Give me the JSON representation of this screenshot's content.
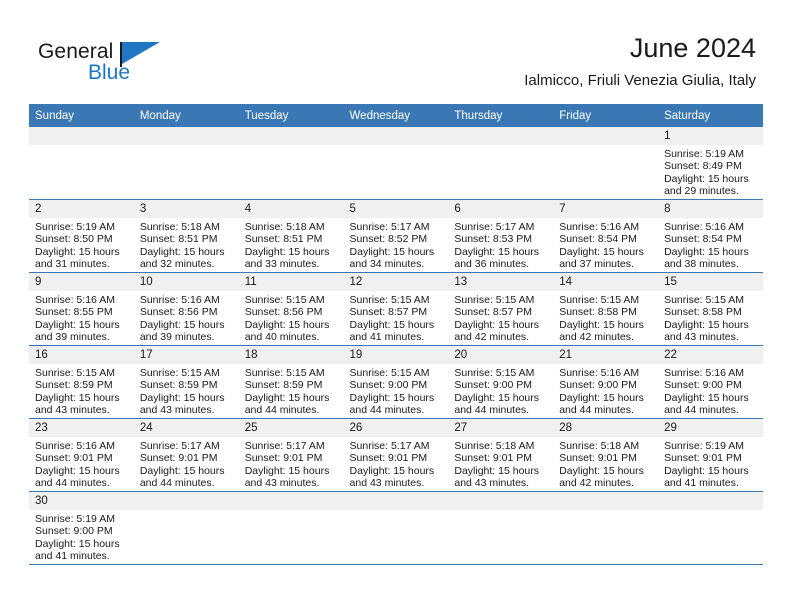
{
  "logo": {
    "text_primary": "General",
    "text_secondary": "Blue",
    "flag_icon": "blue-flag-icon",
    "primary_color": "#1a1a1a",
    "accent_color": "#1f77c4"
  },
  "header": {
    "title": "June 2024",
    "subtitle": "Ialmicco, Friuli Venezia Giulia, Italy"
  },
  "theme": {
    "header_bg": "#3a78b5",
    "header_text": "#ffffff",
    "daynum_bg": "#f0f0f0",
    "row_border": "#3a78b5"
  },
  "calendar": {
    "weekday_headers": [
      "Sunday",
      "Monday",
      "Tuesday",
      "Wednesday",
      "Thursday",
      "Friday",
      "Saturday"
    ],
    "weeks": [
      [
        {
          "day": "",
          "sunrise": "",
          "sunset": "",
          "daylight_line1": "",
          "daylight_line2": ""
        },
        {
          "day": "",
          "sunrise": "",
          "sunset": "",
          "daylight_line1": "",
          "daylight_line2": ""
        },
        {
          "day": "",
          "sunrise": "",
          "sunset": "",
          "daylight_line1": "",
          "daylight_line2": ""
        },
        {
          "day": "",
          "sunrise": "",
          "sunset": "",
          "daylight_line1": "",
          "daylight_line2": ""
        },
        {
          "day": "",
          "sunrise": "",
          "sunset": "",
          "daylight_line1": "",
          "daylight_line2": ""
        },
        {
          "day": "",
          "sunrise": "",
          "sunset": "",
          "daylight_line1": "",
          "daylight_line2": ""
        },
        {
          "day": "1",
          "sunrise": "Sunrise: 5:19 AM",
          "sunset": "Sunset: 8:49 PM",
          "daylight_line1": "Daylight: 15 hours",
          "daylight_line2": "and 29 minutes."
        }
      ],
      [
        {
          "day": "2",
          "sunrise": "Sunrise: 5:19 AM",
          "sunset": "Sunset: 8:50 PM",
          "daylight_line1": "Daylight: 15 hours",
          "daylight_line2": "and 31 minutes."
        },
        {
          "day": "3",
          "sunrise": "Sunrise: 5:18 AM",
          "sunset": "Sunset: 8:51 PM",
          "daylight_line1": "Daylight: 15 hours",
          "daylight_line2": "and 32 minutes."
        },
        {
          "day": "4",
          "sunrise": "Sunrise: 5:18 AM",
          "sunset": "Sunset: 8:51 PM",
          "daylight_line1": "Daylight: 15 hours",
          "daylight_line2": "and 33 minutes."
        },
        {
          "day": "5",
          "sunrise": "Sunrise: 5:17 AM",
          "sunset": "Sunset: 8:52 PM",
          "daylight_line1": "Daylight: 15 hours",
          "daylight_line2": "and 34 minutes."
        },
        {
          "day": "6",
          "sunrise": "Sunrise: 5:17 AM",
          "sunset": "Sunset: 8:53 PM",
          "daylight_line1": "Daylight: 15 hours",
          "daylight_line2": "and 36 minutes."
        },
        {
          "day": "7",
          "sunrise": "Sunrise: 5:16 AM",
          "sunset": "Sunset: 8:54 PM",
          "daylight_line1": "Daylight: 15 hours",
          "daylight_line2": "and 37 minutes."
        },
        {
          "day": "8",
          "sunrise": "Sunrise: 5:16 AM",
          "sunset": "Sunset: 8:54 PM",
          "daylight_line1": "Daylight: 15 hours",
          "daylight_line2": "and 38 minutes."
        }
      ],
      [
        {
          "day": "9",
          "sunrise": "Sunrise: 5:16 AM",
          "sunset": "Sunset: 8:55 PM",
          "daylight_line1": "Daylight: 15 hours",
          "daylight_line2": "and 39 minutes."
        },
        {
          "day": "10",
          "sunrise": "Sunrise: 5:16 AM",
          "sunset": "Sunset: 8:56 PM",
          "daylight_line1": "Daylight: 15 hours",
          "daylight_line2": "and 39 minutes."
        },
        {
          "day": "11",
          "sunrise": "Sunrise: 5:15 AM",
          "sunset": "Sunset: 8:56 PM",
          "daylight_line1": "Daylight: 15 hours",
          "daylight_line2": "and 40 minutes."
        },
        {
          "day": "12",
          "sunrise": "Sunrise: 5:15 AM",
          "sunset": "Sunset: 8:57 PM",
          "daylight_line1": "Daylight: 15 hours",
          "daylight_line2": "and 41 minutes."
        },
        {
          "day": "13",
          "sunrise": "Sunrise: 5:15 AM",
          "sunset": "Sunset: 8:57 PM",
          "daylight_line1": "Daylight: 15 hours",
          "daylight_line2": "and 42 minutes."
        },
        {
          "day": "14",
          "sunrise": "Sunrise: 5:15 AM",
          "sunset": "Sunset: 8:58 PM",
          "daylight_line1": "Daylight: 15 hours",
          "daylight_line2": "and 42 minutes."
        },
        {
          "day": "15",
          "sunrise": "Sunrise: 5:15 AM",
          "sunset": "Sunset: 8:58 PM",
          "daylight_line1": "Daylight: 15 hours",
          "daylight_line2": "and 43 minutes."
        }
      ],
      [
        {
          "day": "16",
          "sunrise": "Sunrise: 5:15 AM",
          "sunset": "Sunset: 8:59 PM",
          "daylight_line1": "Daylight: 15 hours",
          "daylight_line2": "and 43 minutes."
        },
        {
          "day": "17",
          "sunrise": "Sunrise: 5:15 AM",
          "sunset": "Sunset: 8:59 PM",
          "daylight_line1": "Daylight: 15 hours",
          "daylight_line2": "and 43 minutes."
        },
        {
          "day": "18",
          "sunrise": "Sunrise: 5:15 AM",
          "sunset": "Sunset: 8:59 PM",
          "daylight_line1": "Daylight: 15 hours",
          "daylight_line2": "and 44 minutes."
        },
        {
          "day": "19",
          "sunrise": "Sunrise: 5:15 AM",
          "sunset": "Sunset: 9:00 PM",
          "daylight_line1": "Daylight: 15 hours",
          "daylight_line2": "and 44 minutes."
        },
        {
          "day": "20",
          "sunrise": "Sunrise: 5:15 AM",
          "sunset": "Sunset: 9:00 PM",
          "daylight_line1": "Daylight: 15 hours",
          "daylight_line2": "and 44 minutes."
        },
        {
          "day": "21",
          "sunrise": "Sunrise: 5:16 AM",
          "sunset": "Sunset: 9:00 PM",
          "daylight_line1": "Daylight: 15 hours",
          "daylight_line2": "and 44 minutes."
        },
        {
          "day": "22",
          "sunrise": "Sunrise: 5:16 AM",
          "sunset": "Sunset: 9:00 PM",
          "daylight_line1": "Daylight: 15 hours",
          "daylight_line2": "and 44 minutes."
        }
      ],
      [
        {
          "day": "23",
          "sunrise": "Sunrise: 5:16 AM",
          "sunset": "Sunset: 9:01 PM",
          "daylight_line1": "Daylight: 15 hours",
          "daylight_line2": "and 44 minutes."
        },
        {
          "day": "24",
          "sunrise": "Sunrise: 5:17 AM",
          "sunset": "Sunset: 9:01 PM",
          "daylight_line1": "Daylight: 15 hours",
          "daylight_line2": "and 44 minutes."
        },
        {
          "day": "25",
          "sunrise": "Sunrise: 5:17 AM",
          "sunset": "Sunset: 9:01 PM",
          "daylight_line1": "Daylight: 15 hours",
          "daylight_line2": "and 43 minutes."
        },
        {
          "day": "26",
          "sunrise": "Sunrise: 5:17 AM",
          "sunset": "Sunset: 9:01 PM",
          "daylight_line1": "Daylight: 15 hours",
          "daylight_line2": "and 43 minutes."
        },
        {
          "day": "27",
          "sunrise": "Sunrise: 5:18 AM",
          "sunset": "Sunset: 9:01 PM",
          "daylight_line1": "Daylight: 15 hours",
          "daylight_line2": "and 43 minutes."
        },
        {
          "day": "28",
          "sunrise": "Sunrise: 5:18 AM",
          "sunset": "Sunset: 9:01 PM",
          "daylight_line1": "Daylight: 15 hours",
          "daylight_line2": "and 42 minutes."
        },
        {
          "day": "29",
          "sunrise": "Sunrise: 5:19 AM",
          "sunset": "Sunset: 9:01 PM",
          "daylight_line1": "Daylight: 15 hours",
          "daylight_line2": "and 41 minutes."
        }
      ],
      [
        {
          "day": "30",
          "sunrise": "Sunrise: 5:19 AM",
          "sunset": "Sunset: 9:00 PM",
          "daylight_line1": "Daylight: 15 hours",
          "daylight_line2": "and 41 minutes."
        },
        {
          "day": "",
          "sunrise": "",
          "sunset": "",
          "daylight_line1": "",
          "daylight_line2": ""
        },
        {
          "day": "",
          "sunrise": "",
          "sunset": "",
          "daylight_line1": "",
          "daylight_line2": ""
        },
        {
          "day": "",
          "sunrise": "",
          "sunset": "",
          "daylight_line1": "",
          "daylight_line2": ""
        },
        {
          "day": "",
          "sunrise": "",
          "sunset": "",
          "daylight_line1": "",
          "daylight_line2": ""
        },
        {
          "day": "",
          "sunrise": "",
          "sunset": "",
          "daylight_line1": "",
          "daylight_line2": ""
        },
        {
          "day": "",
          "sunrise": "",
          "sunset": "",
          "daylight_line1": "",
          "daylight_line2": ""
        }
      ]
    ]
  }
}
